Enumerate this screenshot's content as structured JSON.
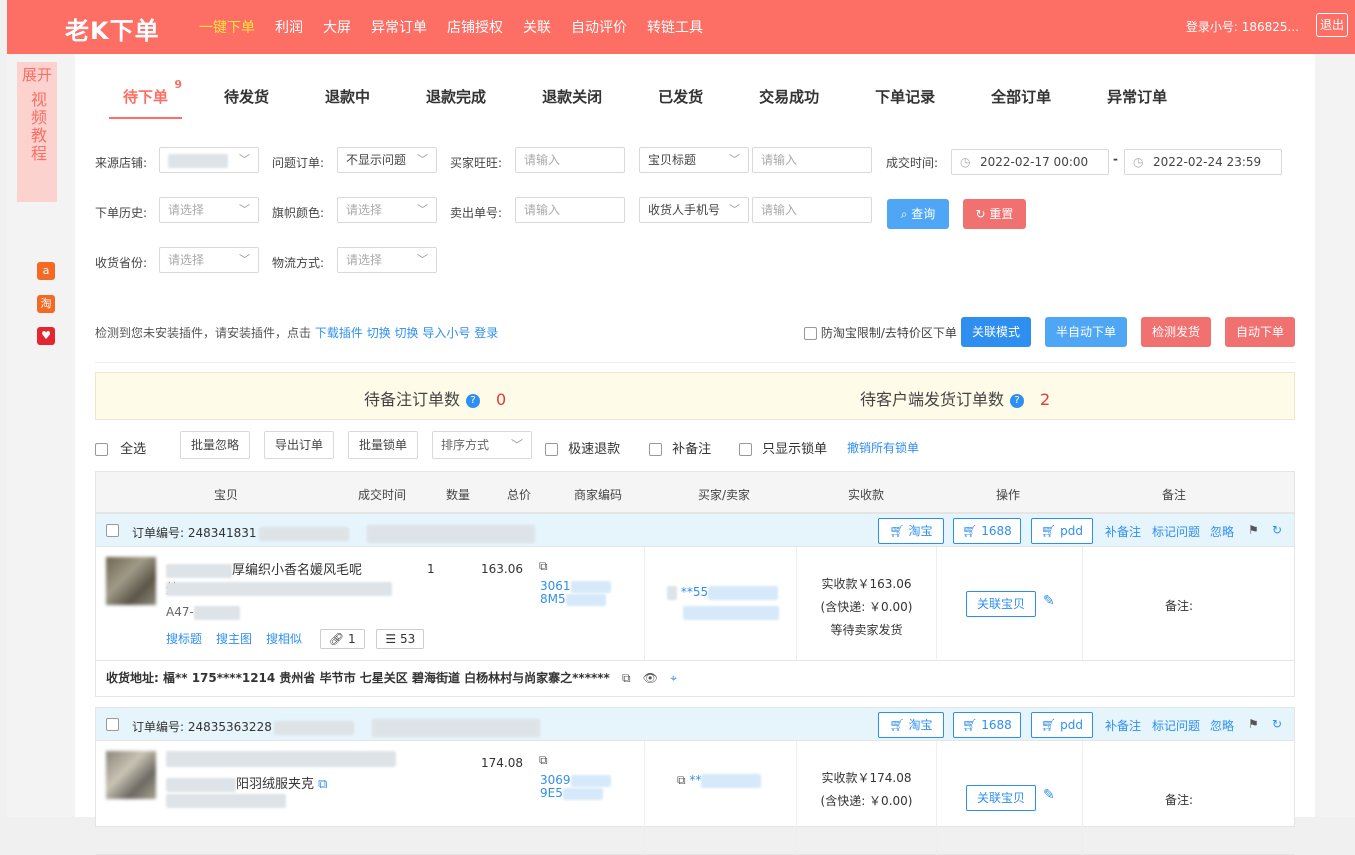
{
  "header": {
    "logo": "老K下单",
    "nav": [
      "一键下单",
      "利润",
      "大屏",
      "异常订单",
      "店铺授权",
      "关联",
      "自动评价",
      "转链工具"
    ],
    "login_text": "登录小号: 186825...",
    "logout": "退出"
  },
  "sidebar": {
    "expand": "展开",
    "video": "视频教程",
    "icons": [
      "alibaba-icon",
      "taobao-icon",
      "pinduoduo-icon"
    ]
  },
  "tabs": [
    {
      "label": "待下单",
      "badge": "9"
    },
    {
      "label": "待发货"
    },
    {
      "label": "退款中"
    },
    {
      "label": "退款完成"
    },
    {
      "label": "退款关闭"
    },
    {
      "label": "已发货"
    },
    {
      "label": "交易成功"
    },
    {
      "label": "下单记录"
    },
    {
      "label": "全部订单"
    },
    {
      "label": "异常订单"
    }
  ],
  "filters": {
    "source_shop": "来源店铺:",
    "problem_order": "问题订单:",
    "problem_value": "不显示问题",
    "buyer_wangwang": "买家旺旺:",
    "placeholder_input": "请输入",
    "placeholder_select": "请选择",
    "item_title": "宝贝标题",
    "deal_time": "成交时间:",
    "date_from": "2022-02-17 00:00",
    "date_to": "2022-02-24 23:59",
    "order_history": "下单历史:",
    "flag_color": "旗帜颜色:",
    "sell_no": "卖出单号:",
    "receiver_phone": "收货人手机号",
    "search": "查询",
    "reset": "重置",
    "province": "收货省份:",
    "logistics": "物流方式:"
  },
  "notice": {
    "text": "检测到您未安装插件，请安装插件，点击",
    "links": [
      "下载插件",
      "切换",
      "切换",
      "导入小号",
      "登录"
    ],
    "restrict": "防淘宝限制/去特价区下单",
    "mode_buttons": [
      "关联模式",
      "半自动下单",
      "检测发货",
      "自动下单"
    ]
  },
  "stats": {
    "pending_note_label": "待备注订单数",
    "pending_note_count": "0",
    "client_ship_label": "待客户端发货订单数",
    "client_ship_count": "2"
  },
  "toolbar": {
    "select_all": "全选",
    "batch_ignore": "批量忽略",
    "export": "导出订单",
    "batch_lock": "批量锁单",
    "sort": "排序方式",
    "fast_refund": "极速退款",
    "add_note": "补备注",
    "only_locked": "只显示锁单",
    "cancel_locks": "撤销所有锁单"
  },
  "table_headers": [
    "宝贝",
    "成交时间",
    "数量",
    "总价",
    "商家编码",
    "买家/卖家",
    "实收款",
    "操作",
    "备注"
  ],
  "orders": [
    {
      "order_no": "订单编号: 248341831",
      "title": "厚编织小香名媛风毛呢外",
      "sku": "A47-",
      "qty": "1",
      "price": "163.06",
      "code": "3061",
      "code2": "8M5",
      "buyer": "**55",
      "received": "实收款￥163.06",
      "shipping": "(含快递: ￥0.00)",
      "status": "等待卖家发货",
      "links": [
        "搜标题",
        "搜主图",
        "搜相似"
      ],
      "link_count": "1",
      "sim_count": "53",
      "address": "收货地址: 楅** 175****1214 贵州省 毕节市 七星关区 碧海街道 白杨林村与尚家寨之******",
      "note": "备注:"
    },
    {
      "order_no": "订单编号: 24835363228",
      "title": "阳羽绒服夹克",
      "price": "174.08",
      "code": "3069",
      "code2": "9E5",
      "buyer": "**",
      "received": "实收款￥174.08",
      "shipping": "(含快递: ￥0.00)",
      "note": "备注:"
    }
  ],
  "order_actions": {
    "taobao": "淘宝",
    "b1688": "1688",
    "pdd": "pdd",
    "add_note": "补备注",
    "mark_problem": "标记问题",
    "ignore": "忽略",
    "link_item": "关联宝贝"
  },
  "colors": {
    "brand": "#fd6e65",
    "link": "#2f8ff0",
    "search_btn": "#4ea6f5",
    "reset_btn": "#f07170"
  }
}
